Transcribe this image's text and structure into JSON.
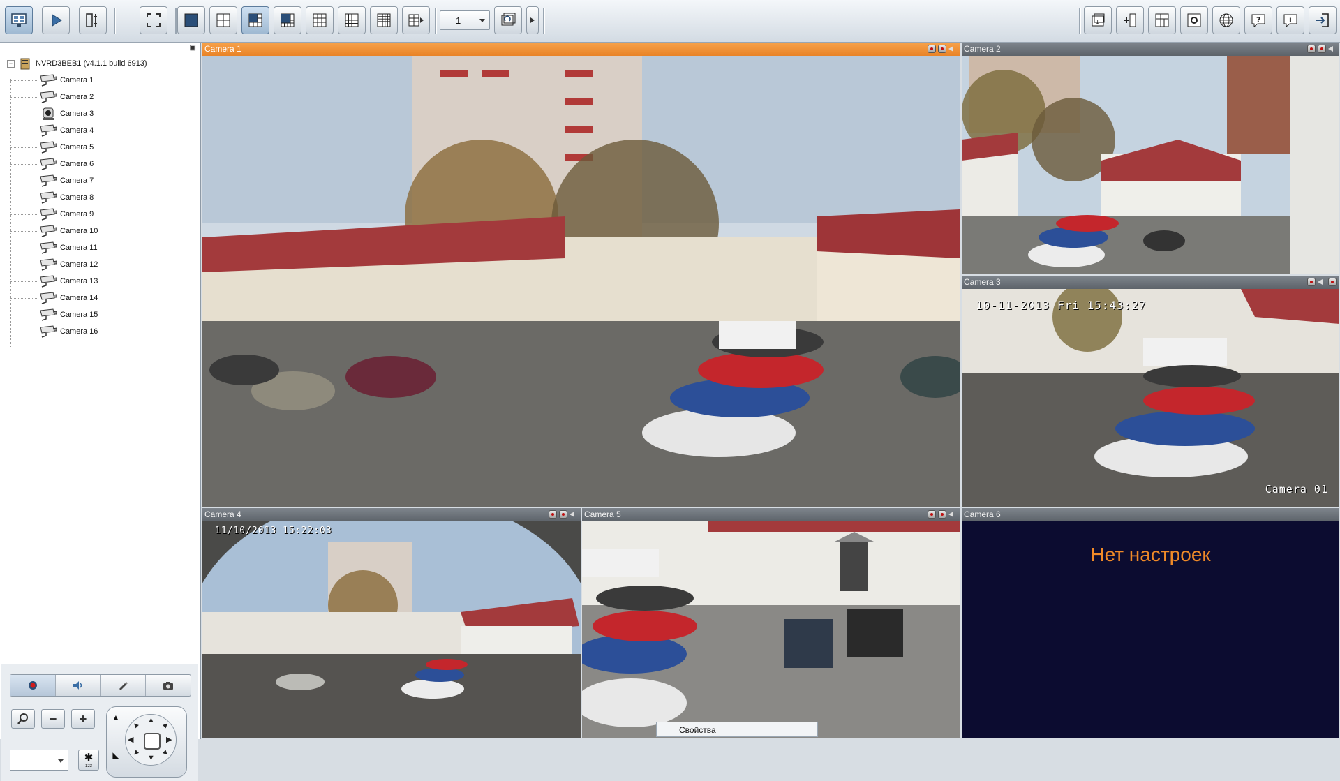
{
  "toolbar": {
    "left_buttons": [
      "live-view-icon",
      "playback-icon",
      "configuration-icon"
    ],
    "layout_buttons": [
      "fullscreen-icon",
      "layout-1x1-icon",
      "layout-2x2-icon",
      "layout-1plus5-icon",
      "layout-1plus7-icon",
      "layout-3x3-icon",
      "layout-4x4-icon",
      "layout-5x5-icon",
      "layout-custom-icon"
    ],
    "page_select_value": "1",
    "right_buttons": [
      "camera-settings-icon",
      "add-device-icon",
      "layout-editor-icon",
      "local-settings-icon",
      "network-icon",
      "help-icon",
      "about-icon",
      "logout-icon"
    ]
  },
  "tree": {
    "server": "NVRD3BEB1 (v4.1.1 build 6913)",
    "cameras": [
      "Camera 1",
      "Camera 2",
      "Camera 3",
      "Camera 4",
      "Camera 5",
      "Camera 6",
      "Camera 7",
      "Camera 8",
      "Camera 9",
      "Camera 10",
      "Camera 11",
      "Camera 12",
      "Camera 13",
      "Camera 14",
      "Camera 15",
      "Camera 16"
    ]
  },
  "ptz": {
    "tabs": [
      "record-icon",
      "audio-icon",
      "paint-icon",
      "snapshot-icon"
    ],
    "zoom_minus": "−",
    "zoom_plus": "+",
    "preset_value": "",
    "preset_go_label": "123"
  },
  "tiles": {
    "cam1": {
      "title": "Camera 1"
    },
    "cam2": {
      "title": "Camera 2"
    },
    "cam3": {
      "title": "Camera 3",
      "osd_time": "10-11-2013 Fri 15:43:27",
      "osd_name": "Camera 01"
    },
    "cam4": {
      "title": "Camera 4",
      "osd_time": "11/10/2013 15:22:03"
    },
    "cam5": {
      "title": "Camera 5"
    },
    "cam6": {
      "title": "Camera 6",
      "message": "Нет настроек"
    }
  },
  "tooltip": "Свойства",
  "colors": {
    "selected_header": "#e98326",
    "header": "#6a7077",
    "empty_feed": "#0c0c30",
    "no_settings_text": "#f08a28"
  }
}
